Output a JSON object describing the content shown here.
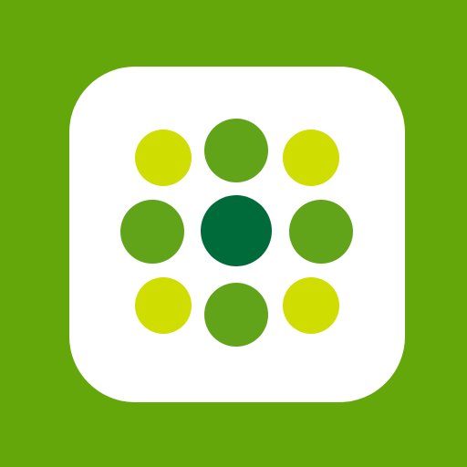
{
  "colors": {
    "background": "#64a70b",
    "tile": "#ffffff",
    "corner_dot": "#cfdd00",
    "edge_dot": "#61a419",
    "center_dot": "#006b3a"
  },
  "icon": {
    "name": "dot-grid-icon"
  }
}
